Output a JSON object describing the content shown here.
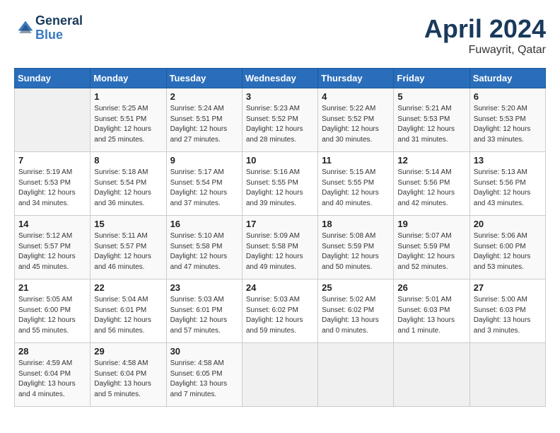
{
  "header": {
    "logo_line1": "General",
    "logo_line2": "Blue",
    "month_title": "April 2024",
    "location": "Fuwayrit, Qatar"
  },
  "weekdays": [
    "Sunday",
    "Monday",
    "Tuesday",
    "Wednesday",
    "Thursday",
    "Friday",
    "Saturday"
  ],
  "weeks": [
    [
      {
        "day": "",
        "info": ""
      },
      {
        "day": "1",
        "info": "Sunrise: 5:25 AM\nSunset: 5:51 PM\nDaylight: 12 hours\nand 25 minutes."
      },
      {
        "day": "2",
        "info": "Sunrise: 5:24 AM\nSunset: 5:51 PM\nDaylight: 12 hours\nand 27 minutes."
      },
      {
        "day": "3",
        "info": "Sunrise: 5:23 AM\nSunset: 5:52 PM\nDaylight: 12 hours\nand 28 minutes."
      },
      {
        "day": "4",
        "info": "Sunrise: 5:22 AM\nSunset: 5:52 PM\nDaylight: 12 hours\nand 30 minutes."
      },
      {
        "day": "5",
        "info": "Sunrise: 5:21 AM\nSunset: 5:53 PM\nDaylight: 12 hours\nand 31 minutes."
      },
      {
        "day": "6",
        "info": "Sunrise: 5:20 AM\nSunset: 5:53 PM\nDaylight: 12 hours\nand 33 minutes."
      }
    ],
    [
      {
        "day": "7",
        "info": "Sunrise: 5:19 AM\nSunset: 5:53 PM\nDaylight: 12 hours\nand 34 minutes."
      },
      {
        "day": "8",
        "info": "Sunrise: 5:18 AM\nSunset: 5:54 PM\nDaylight: 12 hours\nand 36 minutes."
      },
      {
        "day": "9",
        "info": "Sunrise: 5:17 AM\nSunset: 5:54 PM\nDaylight: 12 hours\nand 37 minutes."
      },
      {
        "day": "10",
        "info": "Sunrise: 5:16 AM\nSunset: 5:55 PM\nDaylight: 12 hours\nand 39 minutes."
      },
      {
        "day": "11",
        "info": "Sunrise: 5:15 AM\nSunset: 5:55 PM\nDaylight: 12 hours\nand 40 minutes."
      },
      {
        "day": "12",
        "info": "Sunrise: 5:14 AM\nSunset: 5:56 PM\nDaylight: 12 hours\nand 42 minutes."
      },
      {
        "day": "13",
        "info": "Sunrise: 5:13 AM\nSunset: 5:56 PM\nDaylight: 12 hours\nand 43 minutes."
      }
    ],
    [
      {
        "day": "14",
        "info": "Sunrise: 5:12 AM\nSunset: 5:57 PM\nDaylight: 12 hours\nand 45 minutes."
      },
      {
        "day": "15",
        "info": "Sunrise: 5:11 AM\nSunset: 5:57 PM\nDaylight: 12 hours\nand 46 minutes."
      },
      {
        "day": "16",
        "info": "Sunrise: 5:10 AM\nSunset: 5:58 PM\nDaylight: 12 hours\nand 47 minutes."
      },
      {
        "day": "17",
        "info": "Sunrise: 5:09 AM\nSunset: 5:58 PM\nDaylight: 12 hours\nand 49 minutes."
      },
      {
        "day": "18",
        "info": "Sunrise: 5:08 AM\nSunset: 5:59 PM\nDaylight: 12 hours\nand 50 minutes."
      },
      {
        "day": "19",
        "info": "Sunrise: 5:07 AM\nSunset: 5:59 PM\nDaylight: 12 hours\nand 52 minutes."
      },
      {
        "day": "20",
        "info": "Sunrise: 5:06 AM\nSunset: 6:00 PM\nDaylight: 12 hours\nand 53 minutes."
      }
    ],
    [
      {
        "day": "21",
        "info": "Sunrise: 5:05 AM\nSunset: 6:00 PM\nDaylight: 12 hours\nand 55 minutes."
      },
      {
        "day": "22",
        "info": "Sunrise: 5:04 AM\nSunset: 6:01 PM\nDaylight: 12 hours\nand 56 minutes."
      },
      {
        "day": "23",
        "info": "Sunrise: 5:03 AM\nSunset: 6:01 PM\nDaylight: 12 hours\nand 57 minutes."
      },
      {
        "day": "24",
        "info": "Sunrise: 5:03 AM\nSunset: 6:02 PM\nDaylight: 12 hours\nand 59 minutes."
      },
      {
        "day": "25",
        "info": "Sunrise: 5:02 AM\nSunset: 6:02 PM\nDaylight: 13 hours\nand 0 minutes."
      },
      {
        "day": "26",
        "info": "Sunrise: 5:01 AM\nSunset: 6:03 PM\nDaylight: 13 hours\nand 1 minute."
      },
      {
        "day": "27",
        "info": "Sunrise: 5:00 AM\nSunset: 6:03 PM\nDaylight: 13 hours\nand 3 minutes."
      }
    ],
    [
      {
        "day": "28",
        "info": "Sunrise: 4:59 AM\nSunset: 6:04 PM\nDaylight: 13 hours\nand 4 minutes."
      },
      {
        "day": "29",
        "info": "Sunrise: 4:58 AM\nSunset: 6:04 PM\nDaylight: 13 hours\nand 5 minutes."
      },
      {
        "day": "30",
        "info": "Sunrise: 4:58 AM\nSunset: 6:05 PM\nDaylight: 13 hours\nand 7 minutes."
      },
      {
        "day": "",
        "info": ""
      },
      {
        "day": "",
        "info": ""
      },
      {
        "day": "",
        "info": ""
      },
      {
        "day": "",
        "info": ""
      }
    ]
  ]
}
